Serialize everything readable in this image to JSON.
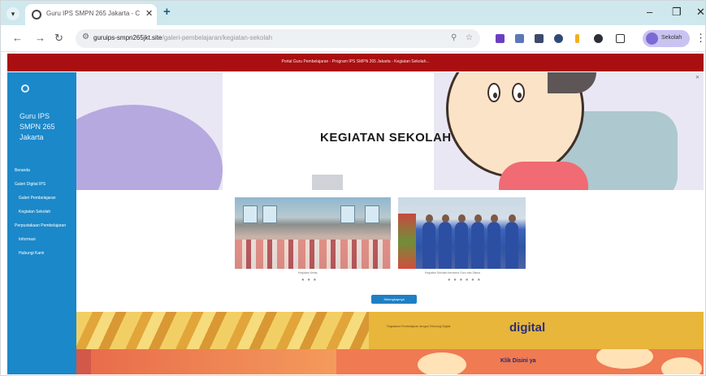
{
  "browser": {
    "tab_title": "Guru IPS SMPN 265 Jakarta - C",
    "url_domain": "guruips-smpn265jkt.site",
    "url_path": "/galeri-pembelajaran/kegiatan-sekolah",
    "profile_label": "Sekolah"
  },
  "announcement": "Portal Guru Pembelajaran - Program IPS SMPN 265 Jakarta - Kegiatan Sekolah...",
  "sidebar": {
    "title": "Guru IPS SMPN 265 Jakarta",
    "items": [
      {
        "label": "Beranda"
      },
      {
        "label": "Galeri Digital IPS"
      },
      {
        "label": "Galeri Pembelajaran"
      },
      {
        "label": "Kegiatan Sekolah"
      },
      {
        "label": "Perpustakaan Pembelajaran"
      },
      {
        "label": "Informasi"
      },
      {
        "label": "Hubungi Kami"
      }
    ]
  },
  "hero": {
    "title": "KEGIATAN SEKOLAH"
  },
  "gallery": {
    "captions": [
      "Kegiatan Kelas",
      "Kegiatan Sekolah bersama Guru dan Siswa"
    ],
    "dots_left": "● ● ●",
    "dots_right": "● ● ● ● ● ●"
  },
  "more_button": "Selengkapnya",
  "banner_digital": {
    "text": "Tingkatkan Pembelajaran dengan Teknologi Digital",
    "brand": "digital"
  },
  "banner_bottom": {
    "text": "Klik Disini ya"
  }
}
